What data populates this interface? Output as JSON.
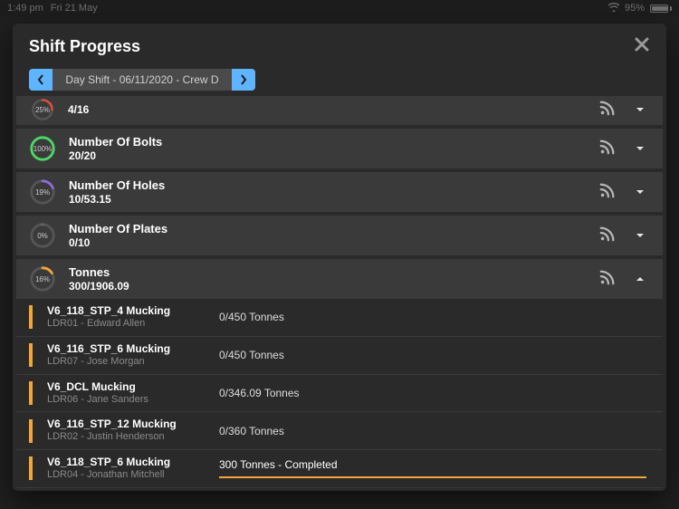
{
  "status": {
    "time": "1:49 pm",
    "date": "Fri 21 May",
    "battery_pct_label": "95%",
    "battery_fill_pct": 95
  },
  "modal": {
    "title": "Shift Progress"
  },
  "shift": {
    "label": "Day Shift - 06/11/2020 - Crew D"
  },
  "metrics": [
    {
      "id": "m0",
      "title": "",
      "value": "4/16",
      "pct": 25,
      "pct_label": "25%",
      "ring_color": "#e74c3c",
      "expanded": false,
      "partial": true
    },
    {
      "id": "m1",
      "title": "Number Of Bolts",
      "value": "20/20",
      "pct": 100,
      "pct_label": "100%",
      "ring_color": "#4cd964",
      "expanded": false
    },
    {
      "id": "m2",
      "title": "Number Of Holes",
      "value": "10/53.15",
      "pct": 19,
      "pct_label": "19%",
      "ring_color": "#8e6bd8",
      "expanded": false
    },
    {
      "id": "m3",
      "title": "Number Of Plates",
      "value": "0/10",
      "pct": 0,
      "pct_label": "0%",
      "ring_color": "#6a6a6a",
      "expanded": false
    },
    {
      "id": "m4",
      "title": "Tonnes",
      "value": "300/1906.09",
      "pct": 16,
      "pct_label": "16%",
      "ring_color": "#f0a63a",
      "expanded": true
    }
  ],
  "tasks": [
    {
      "title": "V6_118_STP_4 Mucking",
      "sub": "LDR01 - Edward Allen",
      "value": "0/450 Tonnes",
      "completed": false
    },
    {
      "title": "V6_116_STP_6 Mucking",
      "sub": "LDR07 - Jose Morgan",
      "value": "0/450 Tonnes",
      "completed": false
    },
    {
      "title": "V6_DCL Mucking",
      "sub": "LDR06 - Jane Sanders",
      "value": "0/346.09 Tonnes",
      "completed": false
    },
    {
      "title": "V6_116_STP_12 Mucking",
      "sub": "LDR02 - Justin Henderson",
      "value": "0/360 Tonnes",
      "completed": false
    },
    {
      "title": "V6_118_STP_6 Mucking",
      "sub": "LDR04 - Jonathan Mitchell",
      "value": "300 Tonnes - Completed",
      "completed": true
    }
  ],
  "colors": {
    "accent_blue": "#5fb4ff",
    "accent_orange": "#f0a63a"
  }
}
